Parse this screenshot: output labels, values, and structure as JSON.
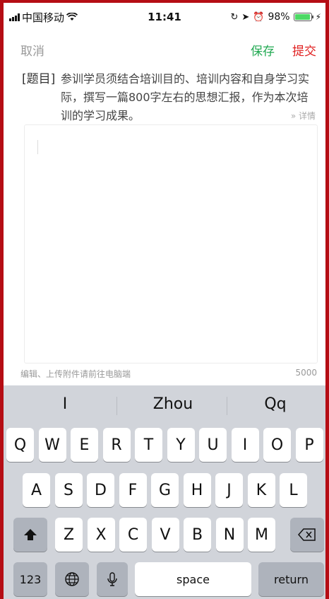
{
  "status_bar": {
    "carrier": "中国移动",
    "wifi_icon": "wifi-icon",
    "time": "11:41",
    "battery": "98%",
    "battery_level": 0.98
  },
  "nav": {
    "cancel": "取消",
    "save": "保存",
    "submit": "提交"
  },
  "topic": {
    "tag": "[题目]",
    "text": "参训学员须结合培训目的、培训内容和自身学习实际，撰写一篇800字左右的思想汇报，作为本次培训的学习成果。",
    "details": "» 详情"
  },
  "editor": {
    "value": "",
    "hint": "编辑、上传附件请前往电脑端",
    "max_chars": "5000"
  },
  "keyboard": {
    "suggestions": [
      "I",
      "Zhou",
      "Qq"
    ],
    "row1": [
      "Q",
      "W",
      "E",
      "R",
      "T",
      "Y",
      "U",
      "I",
      "O",
      "P"
    ],
    "row2": [
      "A",
      "S",
      "D",
      "F",
      "G",
      "H",
      "J",
      "K",
      "L"
    ],
    "row3": [
      "Z",
      "X",
      "C",
      "V",
      "B",
      "N",
      "M"
    ],
    "numbers_key": "123",
    "space_key": "space",
    "return_key": "return"
  },
  "colors": {
    "save": "#22a952",
    "submit": "#e02020",
    "frame": "#b50d14"
  }
}
